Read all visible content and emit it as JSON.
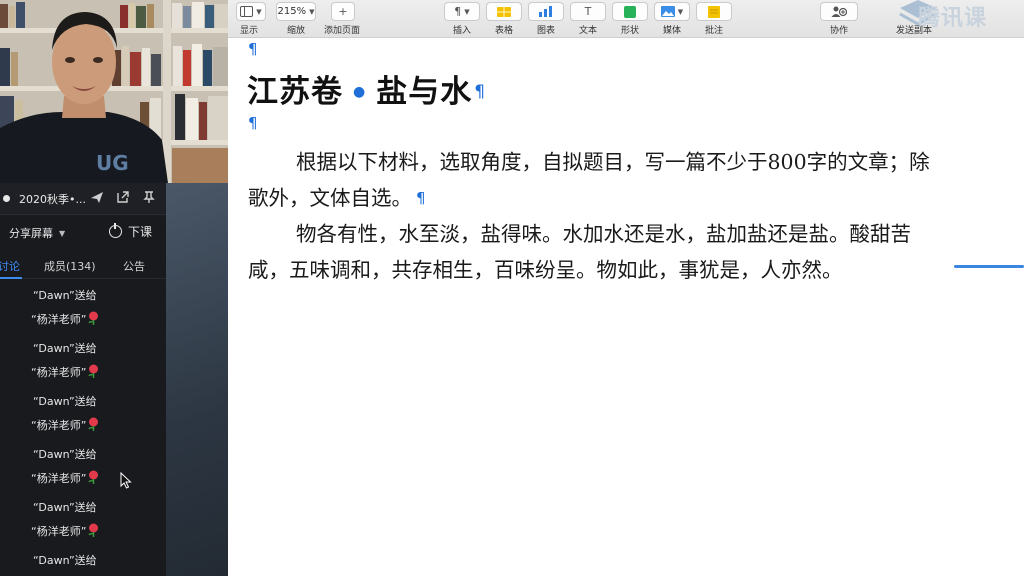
{
  "classroom": {
    "title": "2020秋季•...",
    "share_screen": "分享屏幕",
    "end_class": "下课",
    "tabs": [
      {
        "label": "讨论",
        "active": true
      },
      {
        "label": "成员(134)",
        "active": false
      },
      {
        "label": "公告",
        "active": false
      }
    ],
    "messages": [
      {
        "line1": "“Dawn”送给",
        "line2": "“杨洋老师”"
      },
      {
        "line1": "“Dawn”送给",
        "line2": "“杨洋老师”"
      },
      {
        "line1": "“Dawn”送给",
        "line2": "“杨洋老师”"
      },
      {
        "line1": "“Dawn”送给",
        "line2": "“杨洋老师”"
      },
      {
        "line1": "“Dawn”送给",
        "line2": "“杨洋老师”"
      },
      {
        "line1": "“Dawn”送给",
        "line2": ""
      }
    ]
  },
  "toolbar": {
    "view": "显示",
    "zoom_value": "215%",
    "zoom": "缩放",
    "add_page": "添加页面",
    "insert": "插入",
    "table": "表格",
    "chart": "图表",
    "text": "文本",
    "shape": "形状",
    "media": "媒体",
    "comment": "批注",
    "collaborate": "协作",
    "send_copy": "发送副本"
  },
  "watermark": "腾讯课",
  "document": {
    "title_left": "江苏卷",
    "title_right": "盐与水",
    "para1_line1": "根据以下材料，选取角度，自拟题目，写一篇不少于800字的文章；除",
    "para1_line2": "歌外，文体自选。",
    "para2_line1": "物各有性，水至淡，盐得味。水加水还是水，盐加盐还是盐。酸甜苦",
    "para2_line2": "咸，五味调和，共存相生，百味纷呈。物如此，事犹是，人亦然。"
  },
  "colors": {
    "accent": "#3d8cf0",
    "pilcrow": "#1f6fd8",
    "panel_bg": "#191a1e"
  }
}
